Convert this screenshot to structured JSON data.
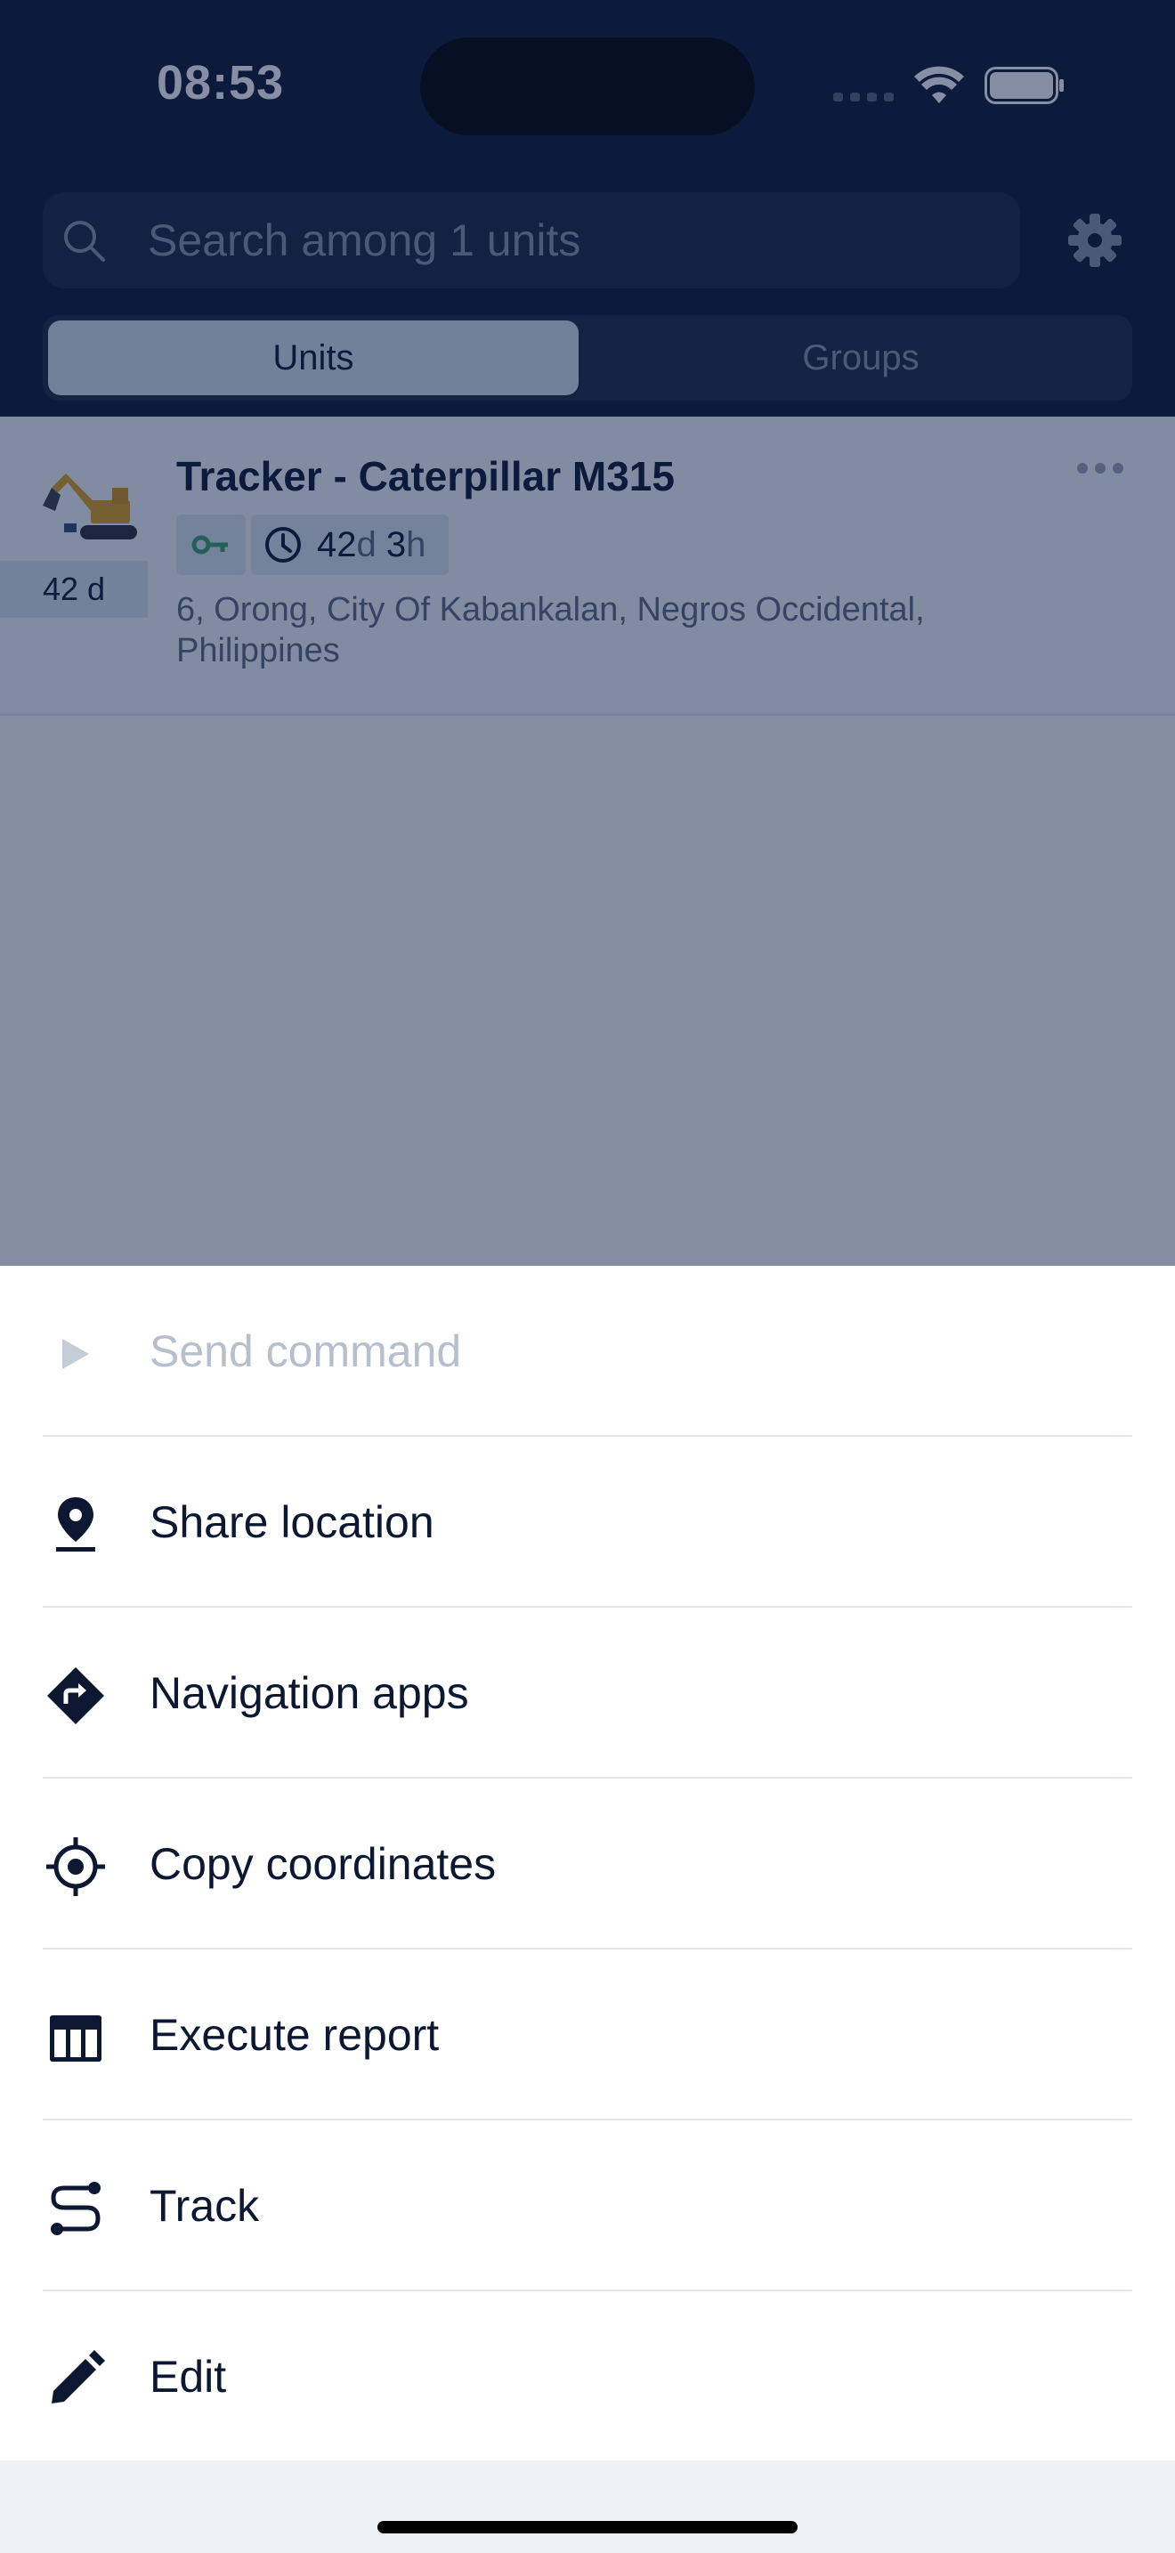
{
  "status_bar": {
    "time": "08:53"
  },
  "search": {
    "placeholder": "Search among 1 units"
  },
  "tabs": [
    {
      "label": "Units",
      "selected": true
    },
    {
      "label": "Groups",
      "selected": false
    }
  ],
  "unit": {
    "name": "Tracker - Caterpillar M315",
    "age_badge": "42 d",
    "duration_days": "42",
    "duration_days_unit": "d",
    "duration_hours": "3",
    "duration_hours_unit": "h",
    "address": "6, Orong, City Of Kabankalan, Negros Occidental, Philippines"
  },
  "actions": [
    {
      "label": "Send command",
      "icon": "play-icon",
      "disabled": true
    },
    {
      "label": "Share location",
      "icon": "location-pin-icon",
      "disabled": false
    },
    {
      "label": "Navigation apps",
      "icon": "directions-icon",
      "disabled": false
    },
    {
      "label": "Copy coordinates",
      "icon": "crosshair-icon",
      "disabled": false
    },
    {
      "label": "Execute report",
      "icon": "table-icon",
      "disabled": false
    },
    {
      "label": "Track",
      "icon": "route-icon",
      "disabled": false
    },
    {
      "label": "Edit",
      "icon": "pencil-icon",
      "disabled": false
    }
  ],
  "colors": {
    "header_bg": "#0c1732",
    "ignition_on": "#3aa56b",
    "text_primary": "#0c1732",
    "text_disabled": "#b7bfcc"
  }
}
